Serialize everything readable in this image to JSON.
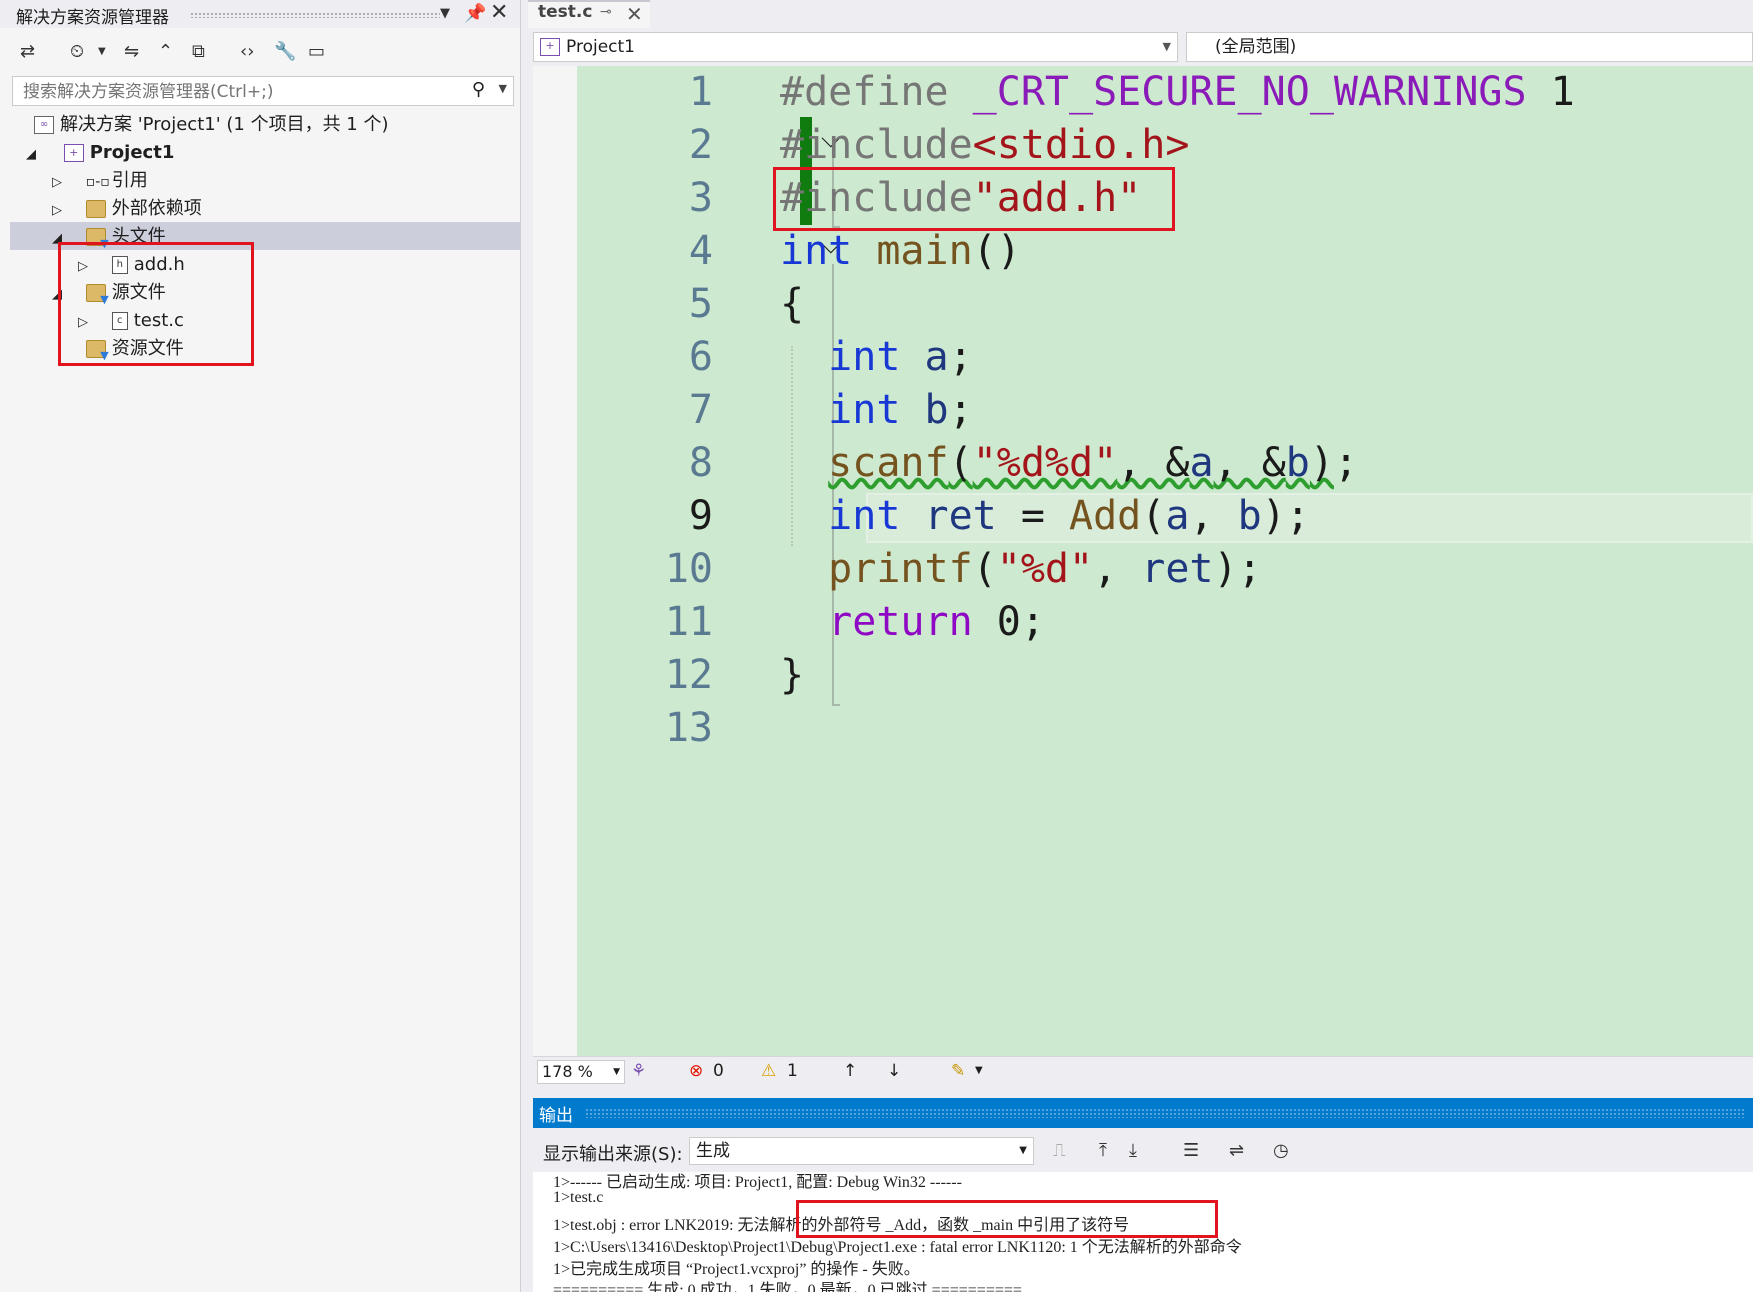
{
  "solution_explorer": {
    "title": "解决方案资源管理器",
    "search_placeholder": "搜索解决方案资源管理器(Ctrl+;)",
    "solution_label": "解决方案 'Project1' (1 个项目，共 1 个)",
    "project": "Project1",
    "references": "引用",
    "external_deps": "外部依赖项",
    "header_files": "头文件",
    "header_file_1": "add.h",
    "source_files": "源文件",
    "source_file_1": "test.c",
    "resource_files": "资源文件"
  },
  "editor": {
    "tab_name": "test.c",
    "project_dropdown": "Project1",
    "scope_dropdown": "(全局范围)",
    "line_numbers": [
      "1",
      "2",
      "3",
      "4",
      "5",
      "6",
      "7",
      "8",
      "9",
      "10",
      "11",
      "12",
      "13"
    ],
    "current_line": "9"
  },
  "status": {
    "zoom": "178 %",
    "errors": "0",
    "warnings": "1"
  },
  "output": {
    "title": "输出",
    "source_label": "显示输出来源(S):",
    "source_value": "生成",
    "lines": [
      "1>------ 已启动生成: 项目: Project1, 配置: Debug Win32 ------",
      "1>test.c",
      "1>test.obj : error LNK2019: 无法解析的外部符号 _Add，函数 _main 中引用了该符号",
      "1>C:\\Users\\13416\\Desktop\\Project1\\Debug\\Project1.exe : fatal error LNK1120: 1 个无法解析的外部命令",
      "1>已完成生成项目 “Project1.vcxproj” 的操作 - 失败。",
      "========== 生成: 0 成功，1 失败，0 最新，0 已跳过 =========="
    ]
  },
  "colors": {
    "editor_bg": "#cde9cf",
    "keyword": "#1838d6",
    "string": "#a3151a",
    "output_header": "#007acc",
    "highlight_box": "#e0141e"
  }
}
